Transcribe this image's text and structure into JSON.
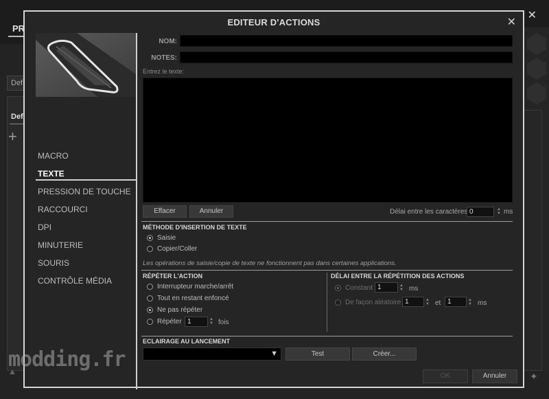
{
  "background": {
    "tab_label": "PR",
    "dropdown_value": "Def",
    "profile_label": "Def",
    "plus_symbol": "+",
    "close_symbol": "✕"
  },
  "modal": {
    "title": "EDITEUR D'ACTIONS",
    "close_symbol": "✕"
  },
  "nav": {
    "items": [
      "MACRO",
      "TEXTE",
      "PRESSION DE TOUCHE",
      "RACCOURCI",
      "DPI",
      "MINUTERIE",
      "SOURIS",
      "CONTRÔLE MÉDIA"
    ],
    "active": "TEXTE"
  },
  "form": {
    "name_label": "NOM:",
    "name_value": "",
    "notes_label": "NOTES:",
    "notes_value": "",
    "text_hint": "Entrez le texte:",
    "clear_button": "Effacer",
    "undo_button": "Annuler",
    "char_delay_label": "Délai entre les caractères",
    "char_delay_value": "0",
    "char_delay_unit": "ms"
  },
  "insertion": {
    "title": "MÉTHODE D'INSERTION DE TEXTE",
    "options": [
      "Saisie",
      "Copier/Coller"
    ],
    "selected": "Saisie",
    "note": "Les opérations de saisie/copie de texte ne fonctionnent pas dans certaines applications."
  },
  "repeat": {
    "title": "RÉPÉTER L'ACTION",
    "options": [
      "Interrupteur marche/arrêt",
      "Tout en restant enfoncé",
      "Ne pas répéter",
      "Répéter"
    ],
    "selected": "Ne pas répéter",
    "repeat_count": "1",
    "repeat_unit": "fois"
  },
  "delay": {
    "title": "DÉLAI ENTRE LA RÉPÉTITION DES ACTIONS",
    "constant_label": "Constant",
    "constant_value": "1",
    "constant_unit": "ms",
    "random_label": "De façon aléatoire",
    "random_min": "1",
    "random_and": "et",
    "random_max": "1",
    "random_unit": "ms"
  },
  "lighting": {
    "title": "ECLAIRAGE AU LANCEMENT",
    "select_value": "",
    "test_button": "Test",
    "create_button": "Créer..."
  },
  "footer": {
    "ok_button": "OK",
    "cancel_button": "Annuler"
  },
  "watermark": "modding.fr",
  "colors": {
    "modal_bg": "#252525",
    "modal_border": "#d6d6d6",
    "input_bg": "#000000"
  }
}
